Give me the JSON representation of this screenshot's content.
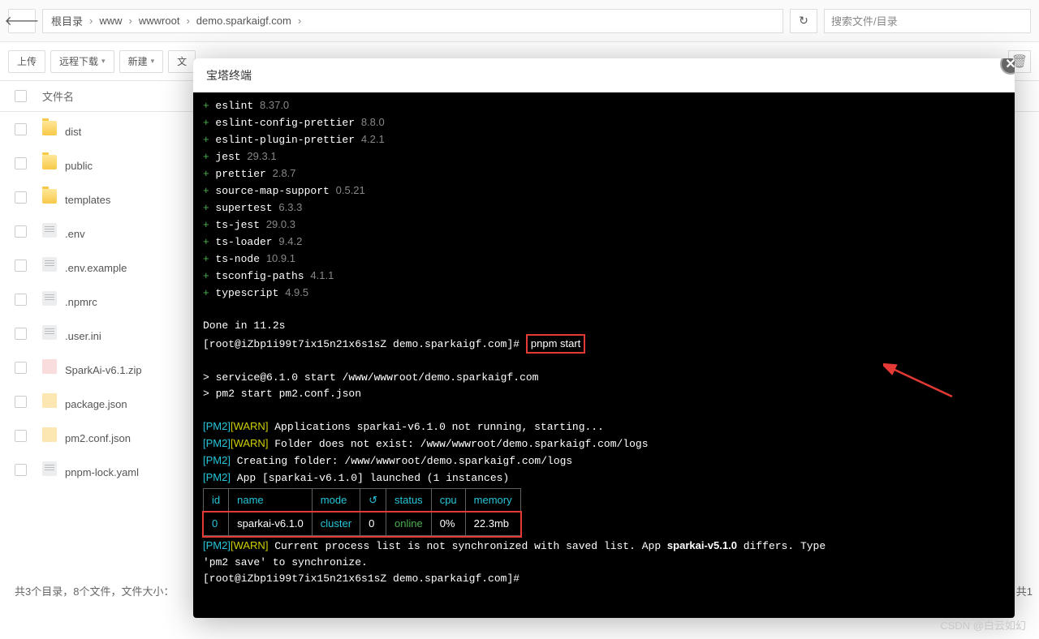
{
  "breadcrumb": {
    "root": "根目录",
    "p1": "www",
    "p2": "wwwroot",
    "p3": "demo.sparkaigf.com"
  },
  "search_placeholder": "搜索文件/目录",
  "toolbar": {
    "upload": "上传",
    "remote": "远程下载",
    "new": "新建",
    "more": "文"
  },
  "cols": {
    "name": "文件名"
  },
  "files": [
    {
      "name": "dist",
      "type": "folder"
    },
    {
      "name": "public",
      "type": "folder"
    },
    {
      "name": "templates",
      "type": "folder"
    },
    {
      "name": ".env",
      "type": "file"
    },
    {
      "name": ".env.example",
      "type": "file"
    },
    {
      "name": ".npmrc",
      "type": "file"
    },
    {
      "name": ".user.ini",
      "type": "file"
    },
    {
      "name": "SparkAi-v6.1.zip",
      "type": "zip"
    },
    {
      "name": "package.json",
      "type": "json"
    },
    {
      "name": "pm2.conf.json",
      "type": "json"
    },
    {
      "name": "pnpm-lock.yaml",
      "type": "file"
    }
  ],
  "footer": "共3个目录，8个文件，文件大小：",
  "footer_suffix": "共1",
  "modal_title": "宝塔终端",
  "term": {
    "deps": [
      {
        "name": "eslint",
        "ver": "8.37.0"
      },
      {
        "name": "eslint-config-prettier",
        "ver": "8.8.0"
      },
      {
        "name": "eslint-plugin-prettier",
        "ver": "4.2.1"
      },
      {
        "name": "jest",
        "ver": "29.3.1"
      },
      {
        "name": "prettier",
        "ver": "2.8.7"
      },
      {
        "name": "source-map-support",
        "ver": "0.5.21"
      },
      {
        "name": "supertest",
        "ver": "6.3.3"
      },
      {
        "name": "ts-jest",
        "ver": "29.0.3"
      },
      {
        "name": "ts-loader",
        "ver": "9.4.2"
      },
      {
        "name": "ts-node",
        "ver": "10.9.1"
      },
      {
        "name": "tsconfig-paths",
        "ver": "4.1.1"
      },
      {
        "name": "typescript",
        "ver": "4.9.5"
      }
    ],
    "done": "Done in 11.2s",
    "prompt": "[root@iZbp1i99t7ix15n21x6s1sZ demo.sparkaigf.com]#",
    "cmd": "pnpm start",
    "svc1": "> service@6.1.0 start /www/wwwroot/demo.sparkaigf.com",
    "svc2": "> pm2 start pm2.conf.json",
    "warn1": " Applications sparkai-v6.1.0 not running, starting...",
    "warn2": " Folder does not exist: /www/wwwroot/demo.sparkaigf.com/logs",
    "info1": " Creating folder: /www/wwwroot/demo.sparkaigf.com/logs",
    "info2": " App [sparkai-v6.1.0] launched (1 instances)",
    "pm2tag": "[PM2]",
    "warntag": "[WARN]",
    "table": {
      "h_id": "id",
      "h_name": "name",
      "h_mode": "mode",
      "h_reload": "↺",
      "h_status": "status",
      "h_cpu": "cpu",
      "h_mem": "memory",
      "id": "0",
      "name": "sparkai-v6.1.0",
      "mode": "cluster",
      "reload": "0",
      "status": "online",
      "cpu": "0%",
      "mem": "22.3mb"
    },
    "final1a": " Current process list is not synchronized with saved list. App ",
    "final1b": "sparkai-v5.1.0",
    "final1c": " differs. Type",
    "final2": "'pm2 save' to synchronize."
  },
  "watermark": "CSDN @白云如幻"
}
